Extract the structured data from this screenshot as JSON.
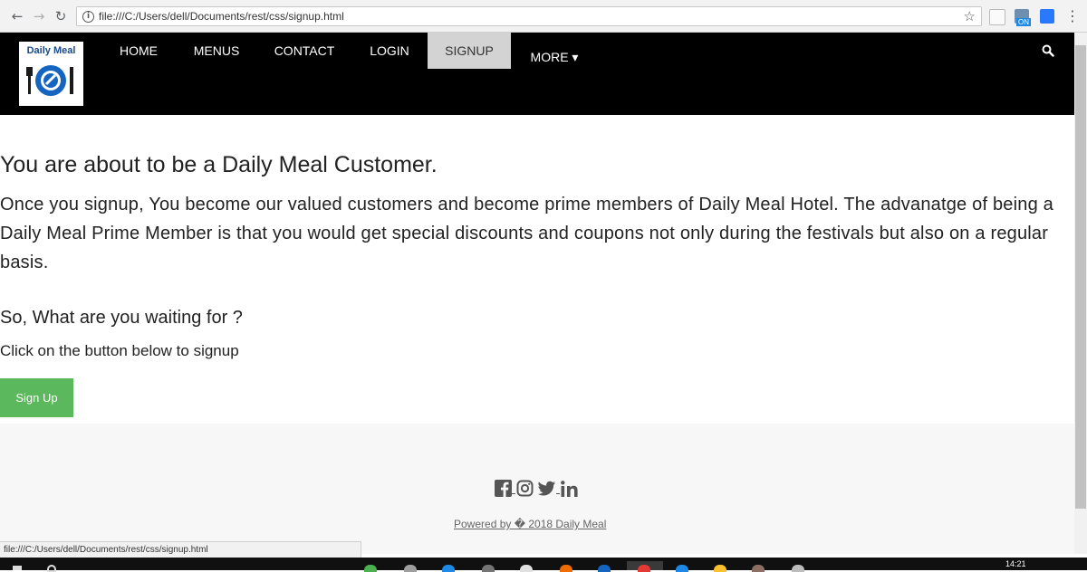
{
  "browser": {
    "url": "file:///C:/Users/dell/Documents/rest/css/signup.html",
    "back_icon": "arrow-left-icon",
    "forward_icon": "arrow-right-icon",
    "reload_icon": "reload-icon",
    "extension_badge": "ON"
  },
  "site": {
    "logo_text": "Daily Meal",
    "nav": [
      {
        "label": "HOME"
      },
      {
        "label": "MENUS"
      },
      {
        "label": "CONTACT"
      },
      {
        "label": "LOGIN"
      },
      {
        "label": "SIGNUP",
        "active": true
      },
      {
        "label": "MORE ▾"
      }
    ]
  },
  "content": {
    "title": "You are about to be a Daily Meal Customer.",
    "paragraph": "Once you signup, You become our valued customers and become prime members of Daily Meal Hotel. The advanatge of being a Daily Meal Prime Member is that you would get special discounts and coupons not only during the festivals but also on a regular basis.",
    "question": "So, What are you waiting for ?",
    "instruction": "Click on the button below to signup",
    "button_label": "Sign Up"
  },
  "footer": {
    "social_icons": [
      "facebook-icon",
      "instagram-icon",
      "twitter-icon",
      "linkedin-icon"
    ],
    "copyright_link": "Powered by � 2018 Daily Meal"
  },
  "status_bar": {
    "text": "file:///C:/Users/dell/Documents/rest/css/signup.html"
  },
  "taskbar": {
    "time": "14:21"
  },
  "colors": {
    "navbar_bg": "#000000",
    "nav_active_bg": "#d3d3d3",
    "button_green": "#5cb85c",
    "footer_bg": "#f7f7f7"
  }
}
